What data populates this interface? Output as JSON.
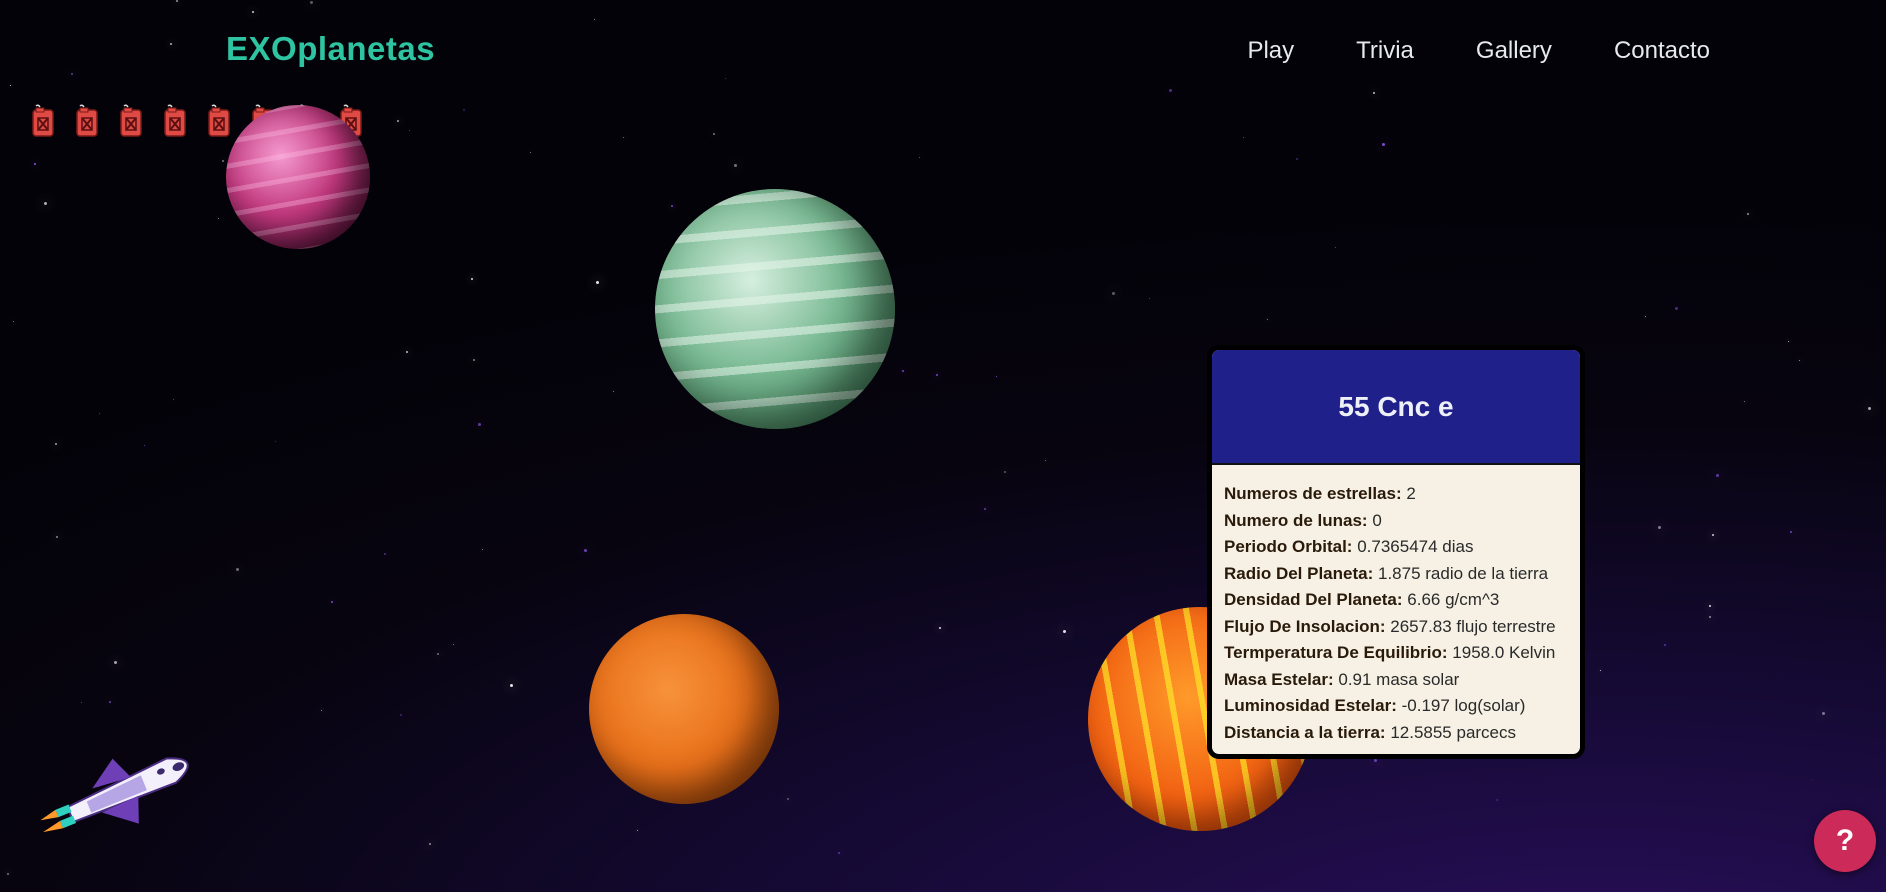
{
  "brand": "EXOplanetas",
  "nav": [
    "Play",
    "Trivia",
    "Gallery",
    "Contacto"
  ],
  "fuel": {
    "count": 8,
    "icon": "fuel-can-icon",
    "color": "#e04a44"
  },
  "planets": [
    "pink-planet",
    "green-planet",
    "orange-planet",
    "lava-planet"
  ],
  "card": {
    "title": "55 Cnc e",
    "rows": [
      {
        "label": "Numeros de estrellas:",
        "value": "2"
      },
      {
        "label": "Numero de lunas:",
        "value": "0"
      },
      {
        "label": "Periodo Orbital:",
        "value": "0.7365474 dias"
      },
      {
        "label": "Radio Del Planeta:",
        "value": "1.875 radio de la tierra"
      },
      {
        "label": "Densidad Del Planeta:",
        "value": "6.66 g/cm^3"
      },
      {
        "label": "Flujo De Insolacion:",
        "value": "2657.83 flujo terrestre"
      },
      {
        "label": "Termperatura De Equilibrio:",
        "value": "1958.0 Kelvin"
      },
      {
        "label": "Masa Estelar:",
        "value": "0.91 masa solar"
      },
      {
        "label": "Luminosidad Estelar:",
        "value": "-0.197 log(solar)"
      },
      {
        "label": "Distancia a la tierra:",
        "value": "12.5855 parcecs"
      }
    ]
  },
  "help_label": "?",
  "colors": {
    "brand": "#2ec4a2",
    "card_header": "#20208a",
    "help": "#cc2a58"
  }
}
